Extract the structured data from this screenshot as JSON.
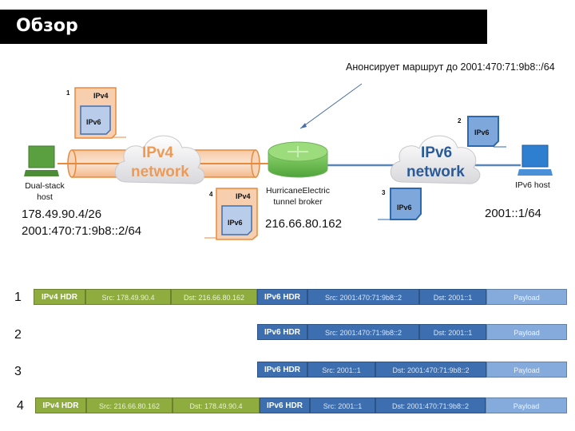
{
  "title": "Обзор",
  "annotation": "Анонсирует маршрут до 2001:470:71:9b8::/64",
  "diagram": {
    "ipv4_cloud": [
      "IPv4",
      "network"
    ],
    "ipv6_cloud": [
      "IPv6",
      "network"
    ],
    "left_host": {
      "label": "Dual-stack host",
      "ipv4": "178.49.90.4/26",
      "ipv6": "2001:470:71:9b8::2/64"
    },
    "broker": {
      "label1": "HurricaneElectric",
      "label2": "tunnel broker",
      "ip": "216.66.80.162"
    },
    "right_host": {
      "label": "IPv6 host",
      "ip": "2001::1/64"
    },
    "packets": [
      {
        "num": "1",
        "outer": "IPv4",
        "inner": "IPv6"
      },
      {
        "num": "2",
        "inner": "IPv6"
      },
      {
        "num": "3",
        "inner": "IPv6"
      },
      {
        "num": "4",
        "outer": "IPv4",
        "inner": "IPv6"
      }
    ]
  },
  "rows": [
    {
      "num": "1",
      "segments": [
        "IPv4 HDR",
        "Src: 178.49.90.4",
        "Dst: 216.66.80.162",
        "IPv6 HDR",
        "Src: 2001:470:71:9b8::2",
        "Dst: 2001::1",
        "Payload"
      ]
    },
    {
      "num": "2",
      "segments": [
        "IPv6 HDR",
        "Src: 2001:470:71:9b8::2",
        "Dst: 2001::1",
        "Payload"
      ]
    },
    {
      "num": "3",
      "segments": [
        "IPv6 HDR",
        "Src: 2001::1",
        "Dst: 2001:470:71:9b8::2",
        "Payload"
      ]
    },
    {
      "num": "4",
      "segments": [
        "IPv4 HDR",
        "Src: 216.66.80.162",
        "Dst: 178.49.90.4",
        "IPv6 HDR",
        "Src: 2001::1",
        "Dst: 2001:470:71:9b8::2",
        "Payload"
      ]
    }
  ],
  "colors": {
    "ipv4_green": "#8fad3f",
    "ipv6_blue": "#3d6fb0",
    "payload": "#84abdc",
    "tunnel_orange": "#f0a060"
  }
}
